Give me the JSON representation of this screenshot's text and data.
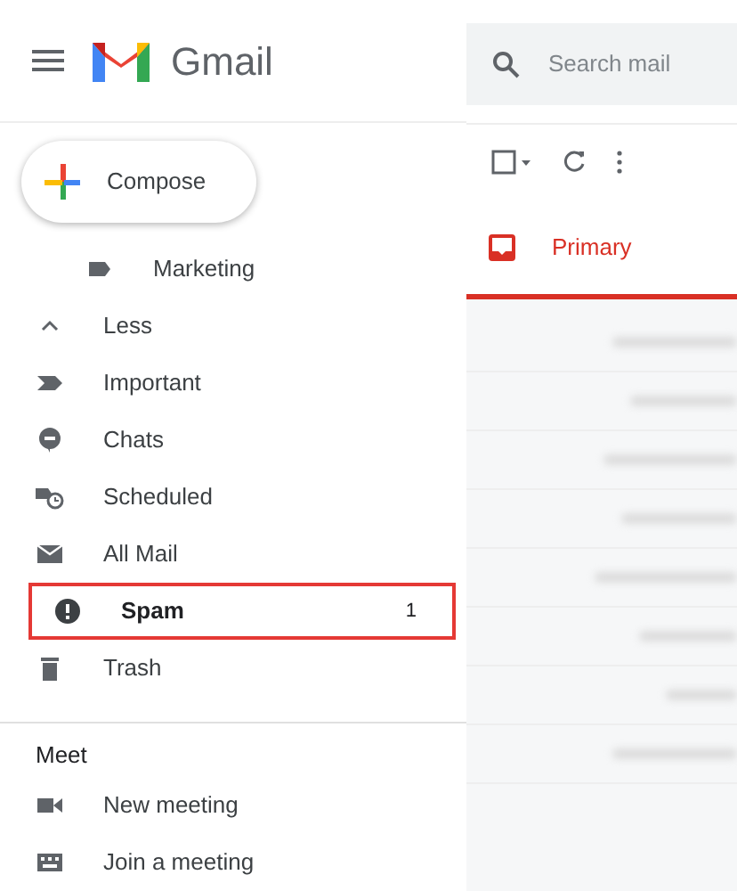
{
  "app": {
    "name": "Gmail"
  },
  "search": {
    "placeholder": "Search mail"
  },
  "compose": {
    "label": "Compose"
  },
  "nav": [
    {
      "label": "Marketing",
      "highlighted": false
    },
    {
      "label": "Less",
      "highlighted": false
    },
    {
      "label": "Important",
      "highlighted": false
    },
    {
      "label": "Chats",
      "highlighted": false
    },
    {
      "label": "Scheduled",
      "highlighted": false
    },
    {
      "label": "All Mail",
      "highlighted": false
    },
    {
      "label": "Spam",
      "highlighted": true,
      "count": "1"
    },
    {
      "label": "Trash",
      "highlighted": false
    }
  ],
  "meet": {
    "heading": "Meet",
    "items": [
      {
        "label": "New meeting"
      },
      {
        "label": "Join a meeting"
      }
    ]
  },
  "tabs": [
    {
      "label": "Primary",
      "selected": true
    }
  ]
}
